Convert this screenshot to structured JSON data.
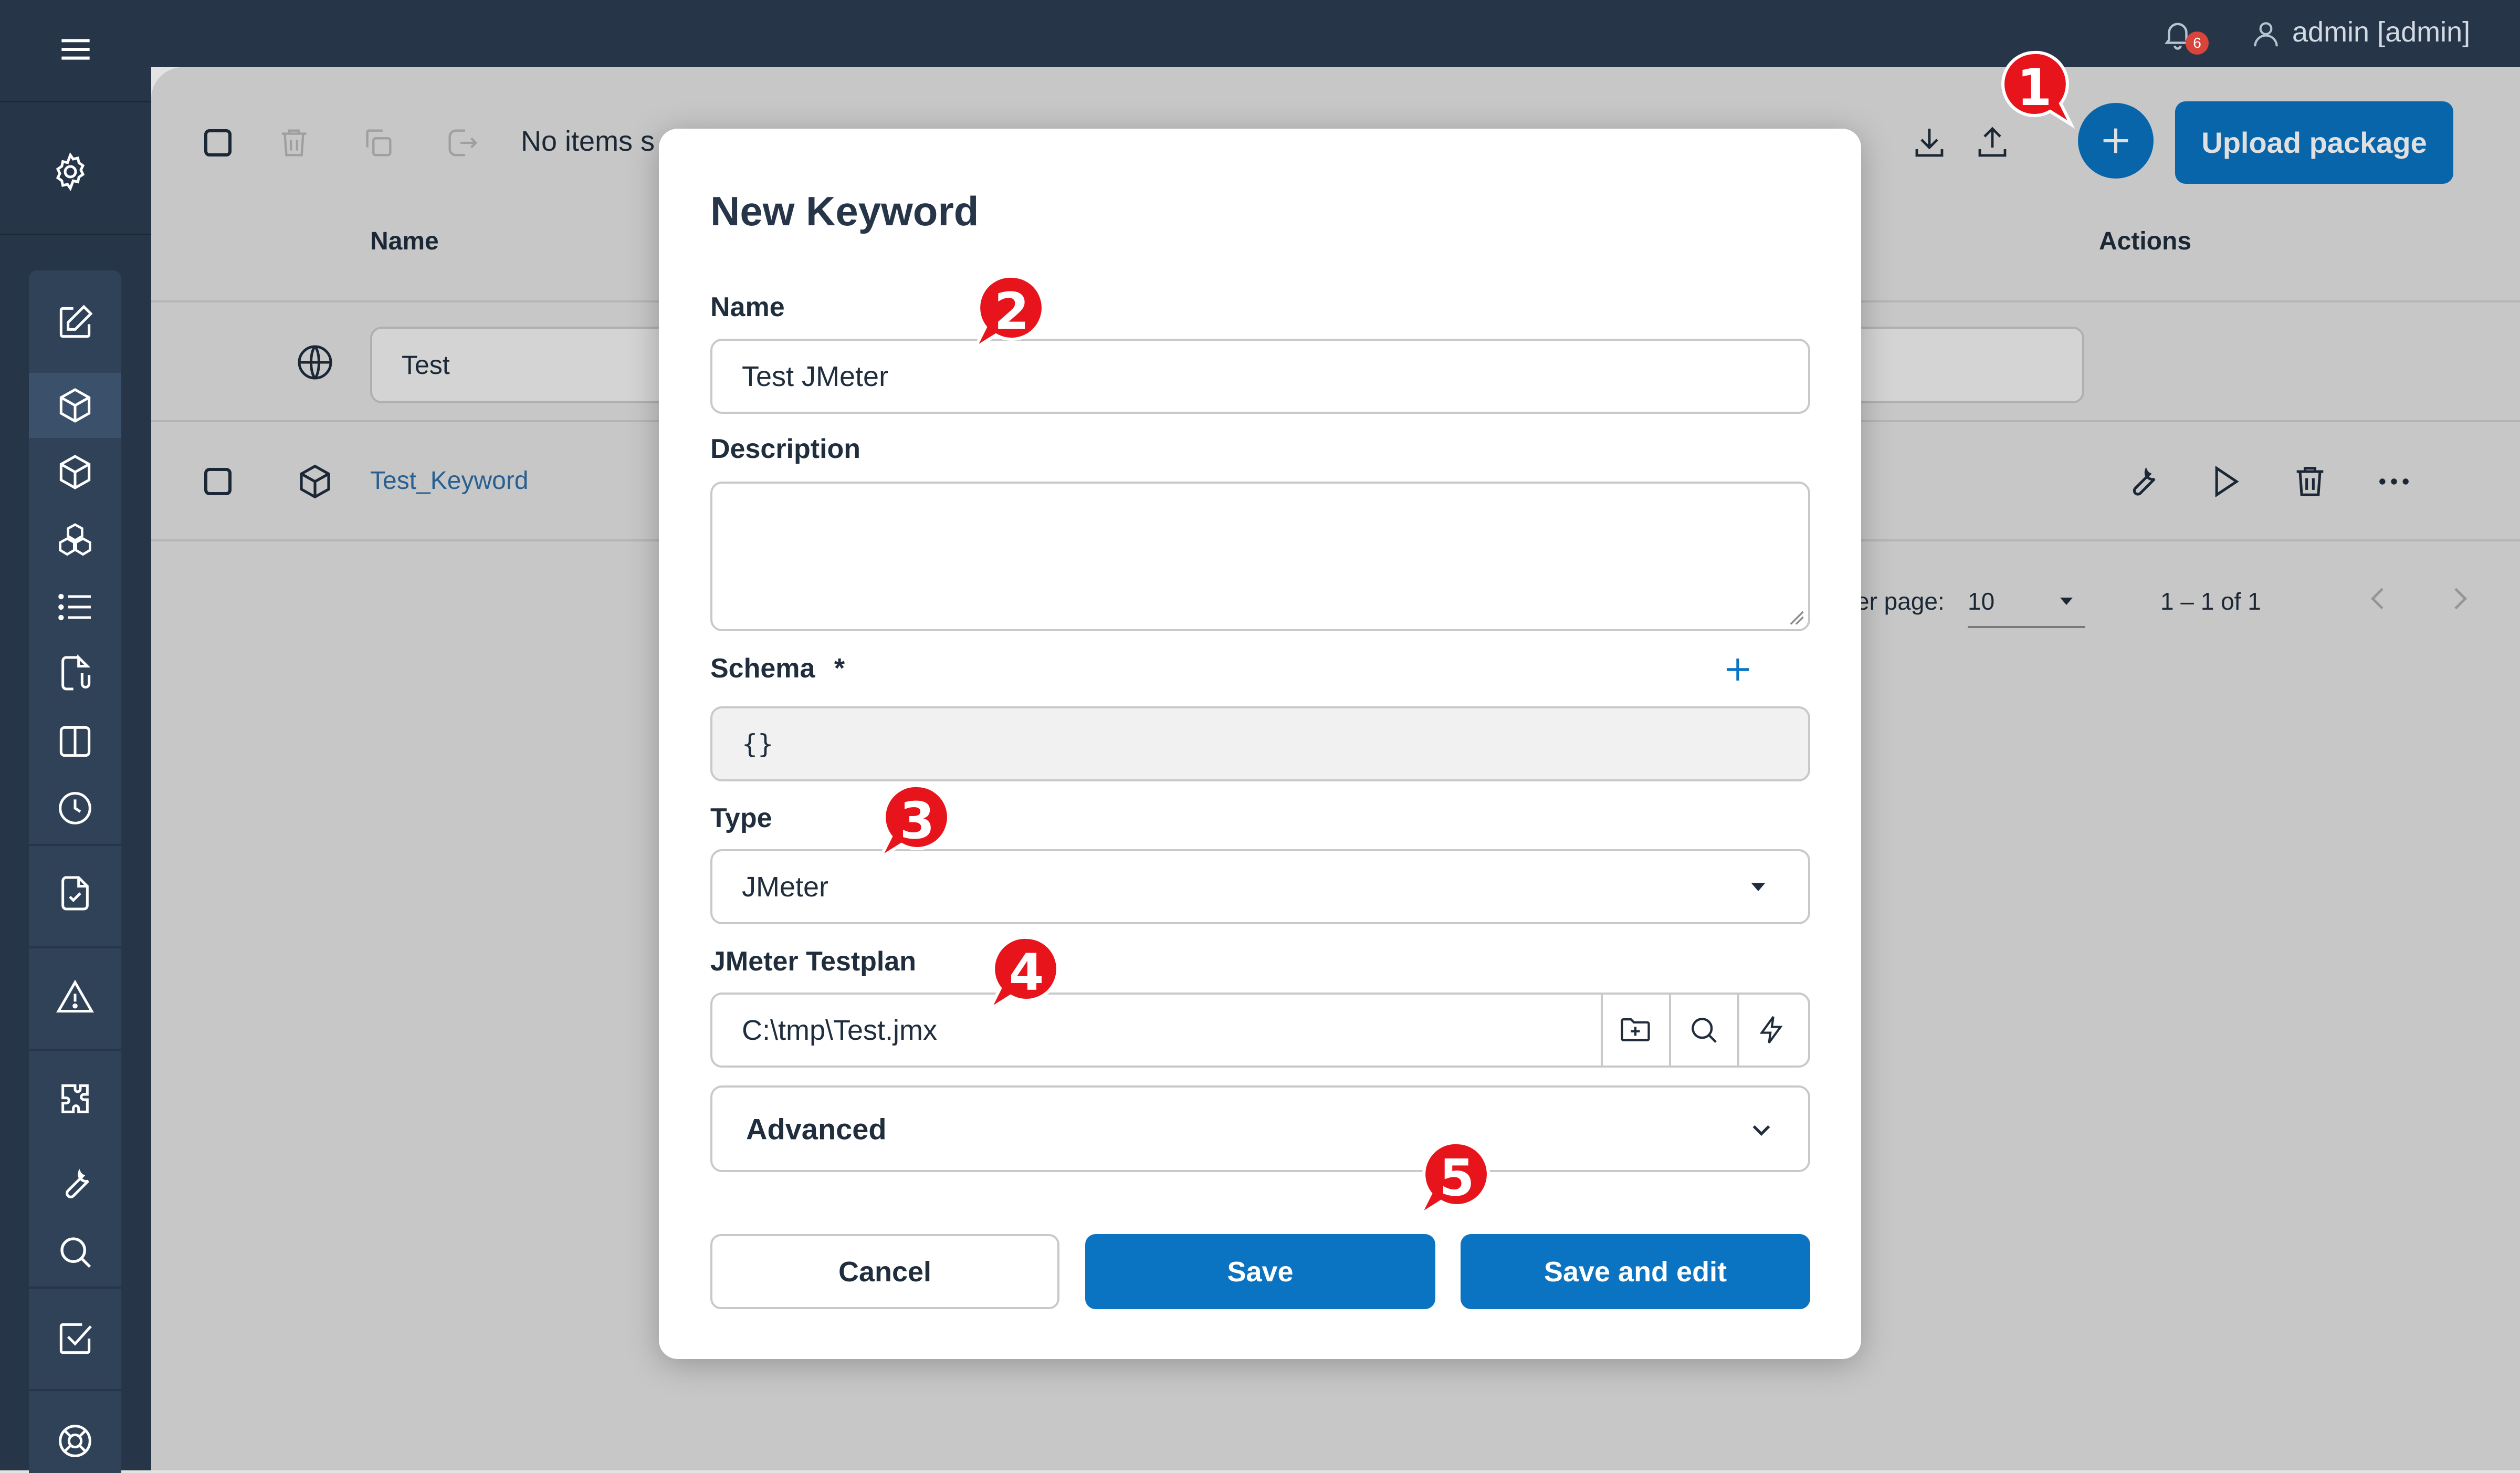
{
  "header": {
    "notification_count": "6",
    "user_label": "admin [admin]"
  },
  "toolbar": {
    "selection_text": "No items s",
    "upload_label": "Upload package"
  },
  "table": {
    "col_name": "Name",
    "col_actions": "Actions",
    "filter_name_value": "Test",
    "row_name": "Test_Keyword"
  },
  "pagination": {
    "per_page_label": "er page:",
    "per_page_value": "10",
    "range": "1 – 1 of 1"
  },
  "dialog": {
    "title": "New Keyword",
    "name_label": "Name",
    "name_value": "Test JMeter",
    "description_label": "Description",
    "description_value": "",
    "schema_label": "Schema",
    "schema_required": "*",
    "schema_value": "{}",
    "type_label": "Type",
    "type_value": "JMeter",
    "testplan_label": "JMeter Testplan",
    "testplan_value": "C:\\tmp\\Test.jmx",
    "advanced_label": "Advanced",
    "cancel_label": "Cancel",
    "save_label": "Save",
    "save_edit_label": "Save and edit"
  },
  "markers": [
    "1",
    "2",
    "3",
    "4",
    "5"
  ],
  "colors": {
    "nav": "#263547",
    "accent": "#0a74c2",
    "marker": "#e8141c",
    "badge": "#d9453a"
  }
}
